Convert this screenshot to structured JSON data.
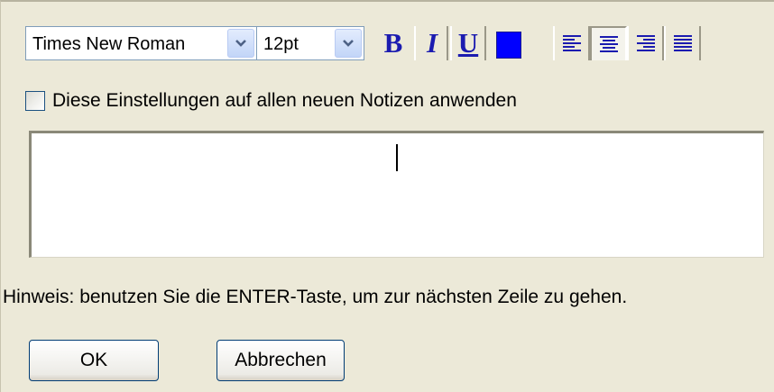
{
  "toolbar": {
    "font_family": "Times New Roman",
    "font_size": "12pt",
    "bold_label": "B",
    "italic_label": "I",
    "underline_label": "U",
    "text_color": "#0000FF",
    "alignment_options": [
      "align-left",
      "align-center",
      "align-right",
      "align-justify"
    ],
    "active_alignment": "align-center",
    "icons": {
      "dropdown": "chevron-down-icon",
      "align_left": "align-left-icon",
      "align_center": "align-center-icon",
      "align_right": "align-right-icon",
      "align_justify": "align-justify-icon"
    }
  },
  "apply_all": {
    "label": "Diese Einstellungen auf allen neuen Notizen anwenden",
    "checked": false
  },
  "note_text": {
    "value": ""
  },
  "hint": {
    "text": "Hinweis: benutzen Sie die ENTER-Taste, um zur nächsten Zeile zu gehen."
  },
  "buttons": {
    "ok_label": "OK",
    "cancel_label": "Abbrechen"
  },
  "colors": {
    "dialog_bg": "#ECE9D8",
    "accent_blue": "#1B1BB0",
    "button_border": "#003C74"
  }
}
